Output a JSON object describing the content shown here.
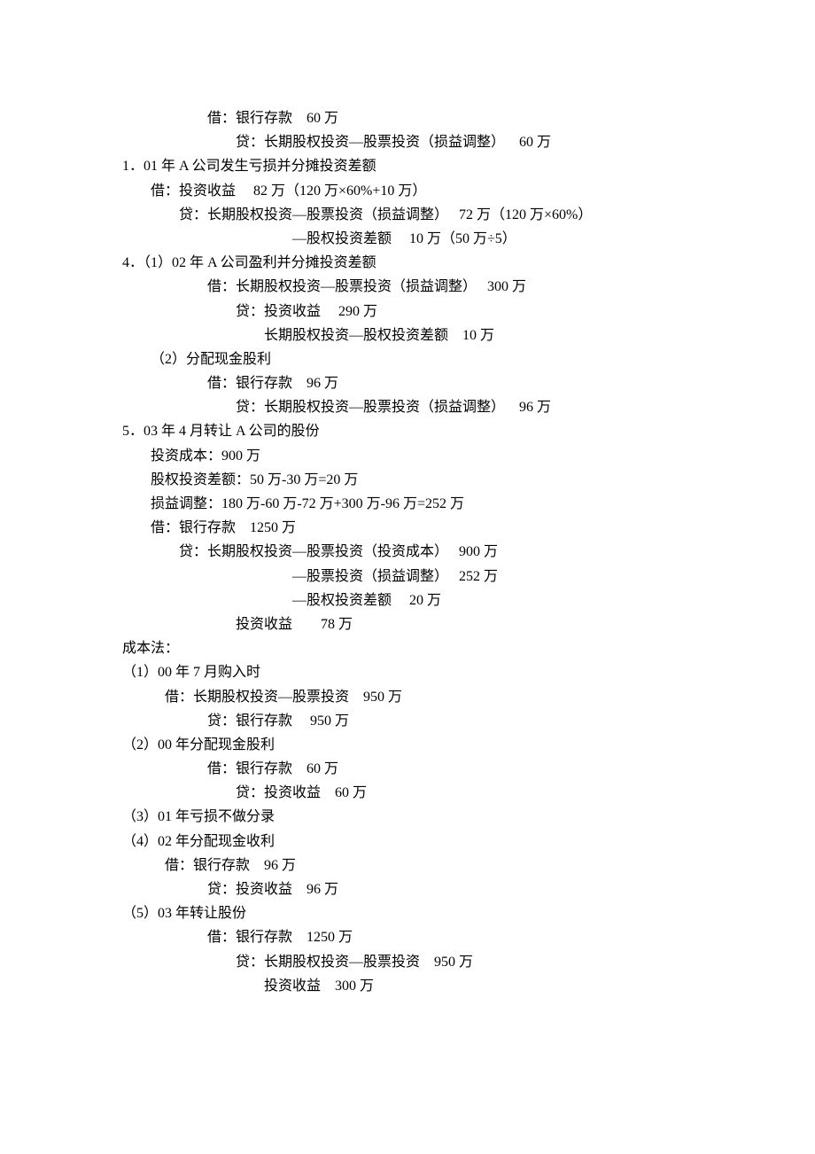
{
  "lines": [
    {
      "cls": "l3",
      "t": "借：银行存款    60 万"
    },
    {
      "cls": "l4",
      "t": "贷：长期股权投资—股票投资（损益调整）    60 万"
    },
    {
      "cls": "l0",
      "t": "1．01 年 A 公司发生亏损并分摊投资差额"
    },
    {
      "cls": "l1",
      "t": "借：投资收益     82 万（120 万×60%+10 万）"
    },
    {
      "cls": "l2",
      "t": "贷：长期股权投资—股票投资（损益调整）   72 万（120 万×60%）"
    },
    {
      "cls": "l6",
      "t": "—股权投资差额     10 万（50 万÷5）"
    },
    {
      "cls": "l0",
      "t": "4．（1）02 年 A 公司盈利并分摊投资差额"
    },
    {
      "cls": "l3",
      "t": "借：长期股权投资—股票投资（损益调整）   300 万"
    },
    {
      "cls": "l4",
      "t": "贷：投资收益     290 万"
    },
    {
      "cls": "l5",
      "t": "长期股权投资—股权投资差额    10 万"
    },
    {
      "cls": "l1",
      "t": "（2）分配现金股利"
    },
    {
      "cls": "l3",
      "t": "借：银行存款    96 万"
    },
    {
      "cls": "l4",
      "t": "贷：长期股权投资—股票投资（损益调整）    96 万"
    },
    {
      "cls": "l0",
      "t": "5．03 年 4 月转让 A 公司的股份"
    },
    {
      "cls": "l1",
      "t": "投资成本：900 万"
    },
    {
      "cls": "l1",
      "t": "股权投资差额：50 万-30 万=20 万"
    },
    {
      "cls": "l1",
      "t": "损益调整：180 万-60 万-72 万+300 万-96 万=252 万"
    },
    {
      "cls": "l1",
      "t": "借：银行存款    1250 万"
    },
    {
      "cls": "l2",
      "t": "贷：长期股权投资—股票投资（投资成本）   900 万"
    },
    {
      "cls": "l6",
      "t": "—股票投资（损益调整）   252 万"
    },
    {
      "cls": "l6",
      "t": "—股权投资差额     20 万"
    },
    {
      "cls": "l4",
      "t": "投资收益        78 万"
    },
    {
      "cls": "l0",
      "t": "成本法："
    },
    {
      "cls": "l0",
      "t": "（1）00 年 7 月购入时"
    },
    {
      "cls": "l2b",
      "t": "借：长期股权投资—股票投资    950 万"
    },
    {
      "cls": "l3",
      "t": "贷：银行存款     950 万"
    },
    {
      "cls": "l0",
      "t": "（2）00 年分配现金股利"
    },
    {
      "cls": "l3",
      "t": "借：银行存款    60 万"
    },
    {
      "cls": "l4",
      "t": "贷：投资收益    60 万"
    },
    {
      "cls": "l0",
      "t": "（3）01 年亏损不做分录"
    },
    {
      "cls": "l0",
      "t": "（4）02 年分配现金收利"
    },
    {
      "cls": "l2b",
      "t": "借：银行存款    96 万"
    },
    {
      "cls": "l3",
      "t": "贷：投资收益    96 万"
    },
    {
      "cls": "l0",
      "t": "（5）03 年转让股份"
    },
    {
      "cls": "l3",
      "t": "借：银行存款    1250 万"
    },
    {
      "cls": "l4",
      "t": "贷：长期股权投资—股票投资    950 万"
    },
    {
      "cls": "l5",
      "t": "投资收益    300 万"
    }
  ]
}
